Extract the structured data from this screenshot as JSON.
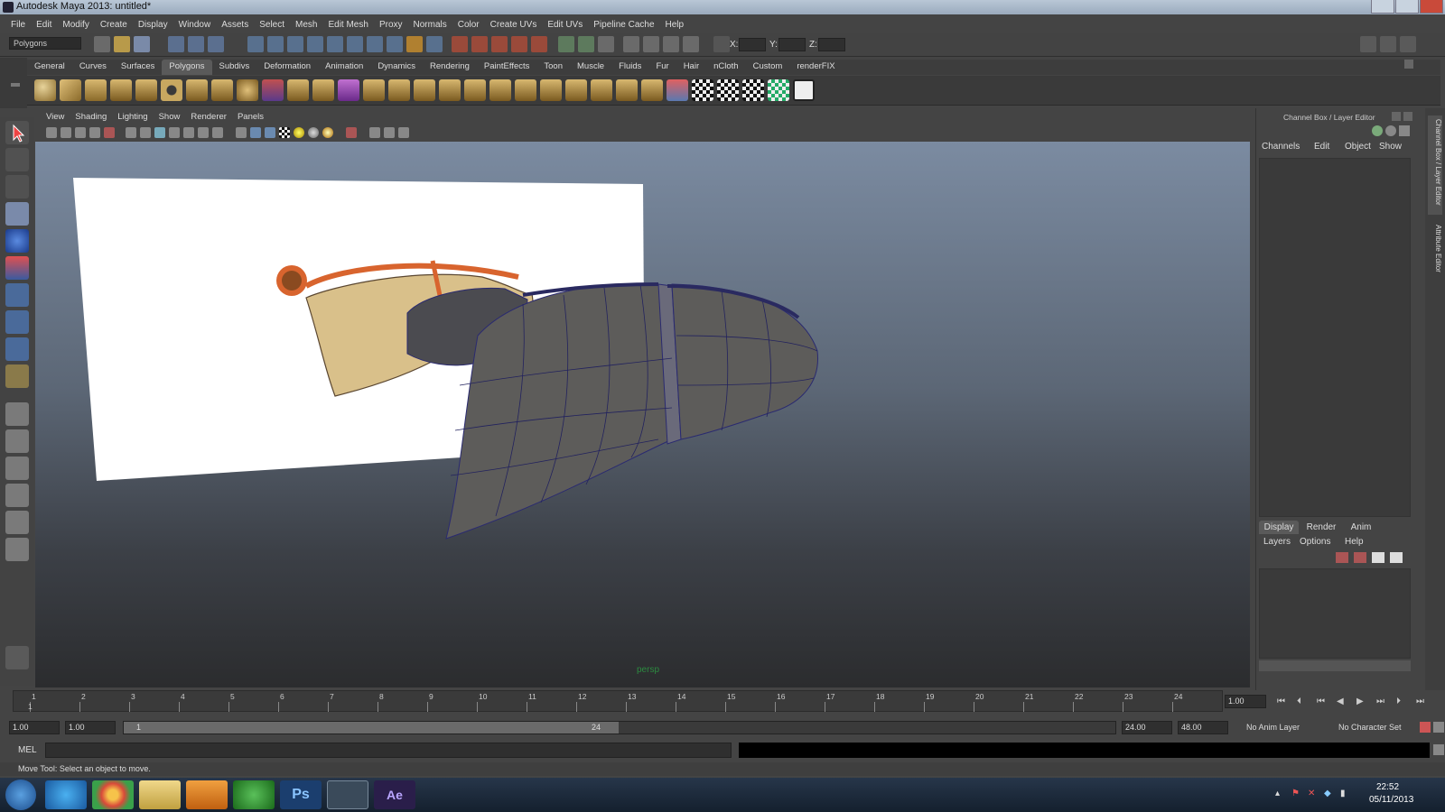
{
  "window": {
    "title": "Autodesk Maya 2013: untitled*"
  },
  "menubar": [
    "File",
    "Edit",
    "Modify",
    "Create",
    "Display",
    "Window",
    "Assets",
    "Select",
    "Mesh",
    "Edit Mesh",
    "Proxy",
    "Normals",
    "Color",
    "Create UVs",
    "Edit UVs",
    "Pipeline Cache",
    "Help"
  ],
  "statusline": {
    "mode": "Polygons",
    "x_label": "X:",
    "y_label": "Y:",
    "z_label": "Z:"
  },
  "shelf_tabs": [
    "General",
    "Curves",
    "Surfaces",
    "Polygons",
    "Subdivs",
    "Deformation",
    "Animation",
    "Dynamics",
    "Rendering",
    "PaintEffects",
    "Toon",
    "Muscle",
    "Fluids",
    "Fur",
    "Hair",
    "nCloth",
    "Custom",
    "renderFIX"
  ],
  "shelf_active": "Polygons",
  "viewport": {
    "menu": [
      "View",
      "Shading",
      "Lighting",
      "Show",
      "Renderer",
      "Panels"
    ],
    "camera": "persp"
  },
  "channel_box": {
    "title": "Channel Box / Layer Editor",
    "menu": [
      "Channels",
      "Edit",
      "Object",
      "Show"
    ],
    "layer_tabs": [
      "Display",
      "Render",
      "Anim"
    ],
    "layer_menu": [
      "Layers",
      "Options",
      "Help"
    ]
  },
  "side_tabs": [
    "Channel Box / Layer Editor",
    "Attribute Editor"
  ],
  "timeline": {
    "ticks": [
      "1",
      "2",
      "3",
      "4",
      "5",
      "6",
      "7",
      "8",
      "9",
      "10",
      "11",
      "12",
      "13",
      "14",
      "15",
      "16",
      "17",
      "18",
      "19",
      "20",
      "21",
      "22",
      "23",
      "24"
    ],
    "current_frame": "1.00"
  },
  "range": {
    "start": "1.00",
    "playback_start": "1.00",
    "slider_min": "1",
    "slider_max": "24",
    "playback_end": "24.00",
    "end": "48.00",
    "anim_layer": "No Anim Layer",
    "character_set": "No Character Set"
  },
  "command": {
    "label": "MEL"
  },
  "help_line": "Move Tool: Select an object to move.",
  "taskbar": {
    "time": "22:52",
    "date": "05/11/2013"
  }
}
